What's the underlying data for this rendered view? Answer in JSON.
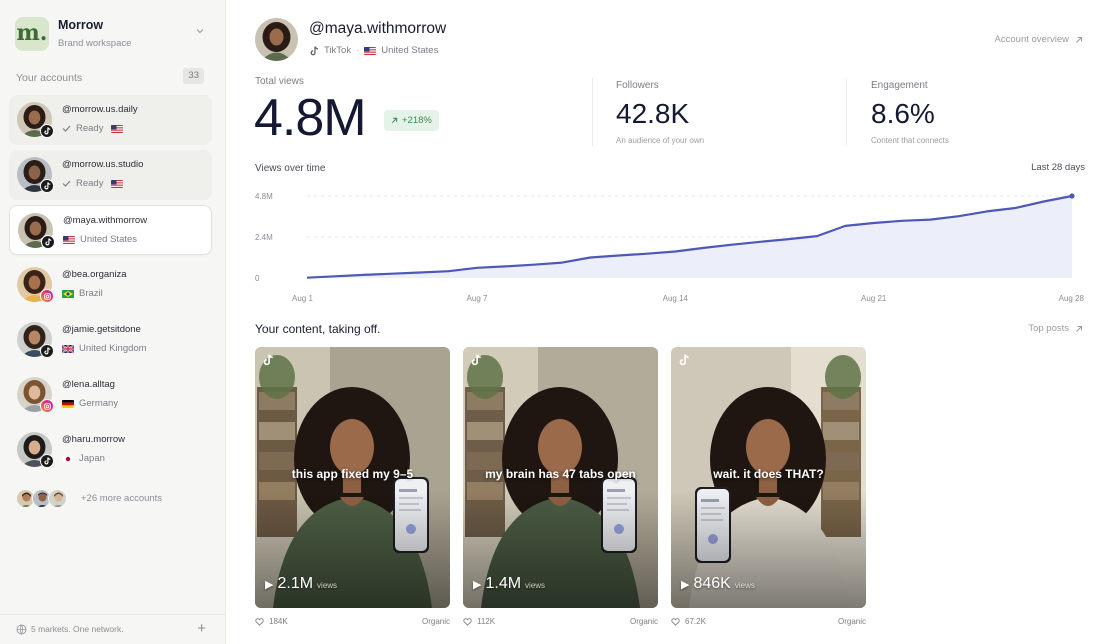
{
  "workspace": {
    "logo_letter": "m.",
    "name": "Morrow",
    "subtitle": "Brand workspace"
  },
  "accounts_header": {
    "title": "Your accounts",
    "count": "33"
  },
  "accounts": [
    {
      "handle": "@morrow.us.daily",
      "status": "Ready",
      "country": "",
      "flag": "US",
      "platform": "tiktok",
      "state": "ready"
    },
    {
      "handle": "@morrow.us.studio",
      "status": "Ready",
      "country": "",
      "flag": "US",
      "platform": "tiktok",
      "state": "ready"
    },
    {
      "handle": "@maya.withmorrow",
      "status": "",
      "country": "United States",
      "flag": "US",
      "platform": "tiktok",
      "state": "active"
    },
    {
      "handle": "@bea.organiza",
      "status": "",
      "country": "Brazil",
      "flag": "BR",
      "platform": "instagram",
      "state": "normal"
    },
    {
      "handle": "@jamie.getsitdone",
      "status": "",
      "country": "United Kingdom",
      "flag": "GB",
      "platform": "tiktok",
      "state": "normal"
    },
    {
      "handle": "@lena.alltag",
      "status": "",
      "country": "Germany",
      "flag": "DE",
      "platform": "instagram",
      "state": "normal"
    },
    {
      "handle": "@haru.morrow",
      "status": "",
      "country": "Japan",
      "flag": "JP",
      "platform": "tiktok",
      "state": "normal"
    }
  ],
  "more_accounts": "+26 more accounts",
  "sidebar_footer": {
    "text": "5 markets. One network."
  },
  "profile": {
    "handle": "@maya.withmorrow",
    "platform": "TikTok",
    "country": "United States",
    "flag": "US"
  },
  "account_overview_link": "Account overview",
  "stats": {
    "total_views": {
      "label": "Total views",
      "value": "4.8M",
      "growth": "+218%"
    },
    "followers": {
      "label": "Followers",
      "value": "42.8K",
      "sub": "An audience of your own"
    },
    "engagement": {
      "label": "Engagement",
      "value": "8.6%",
      "sub": "Content that connects"
    }
  },
  "chart_title": "Views over time",
  "chart_range": "Last 28 days",
  "chart_data": {
    "type": "area",
    "xlabel": "",
    "ylabel": "",
    "ylim": [
      0,
      4.8
    ],
    "y_unit": "M",
    "y_ticks": [
      "0",
      "2.4M",
      "4.8M"
    ],
    "x_ticks": [
      "Aug 1",
      "Aug 7",
      "Aug 14",
      "Aug 21",
      "Aug 28"
    ],
    "x": [
      1,
      2,
      3,
      4,
      5,
      6,
      7,
      8,
      9,
      10,
      11,
      12,
      13,
      14,
      15,
      16,
      17,
      18,
      19,
      20,
      21,
      22,
      23,
      24,
      25,
      26,
      27,
      28
    ],
    "series": [
      {
        "values": [
          0.02,
          0.1,
          0.18,
          0.25,
          0.32,
          0.4,
          0.6,
          0.68,
          0.78,
          0.9,
          1.2,
          1.32,
          1.42,
          1.55,
          1.76,
          1.95,
          2.12,
          2.28,
          2.45,
          3.05,
          3.22,
          3.35,
          3.42,
          3.62,
          3.9,
          4.1,
          4.48,
          4.8
        ]
      }
    ],
    "grid": true,
    "legend": "none",
    "line_color": "#4e58b6",
    "fill_color": "#eceef9"
  },
  "section_title": "Your content, taking off.",
  "top_posts_link": "Top posts",
  "posts": [
    {
      "caption": "this app fixed my 9–5",
      "views": "2.1M",
      "views_label": "views",
      "likes": "184K",
      "type": "Organic"
    },
    {
      "caption": "my brain has 47 tabs open",
      "views": "1.4M",
      "views_label": "views",
      "likes": "112K",
      "type": "Organic"
    },
    {
      "caption": "wait. it does THAT?",
      "views": "846K",
      "views_label": "views",
      "likes": "67.2K",
      "type": "Organic"
    }
  ]
}
